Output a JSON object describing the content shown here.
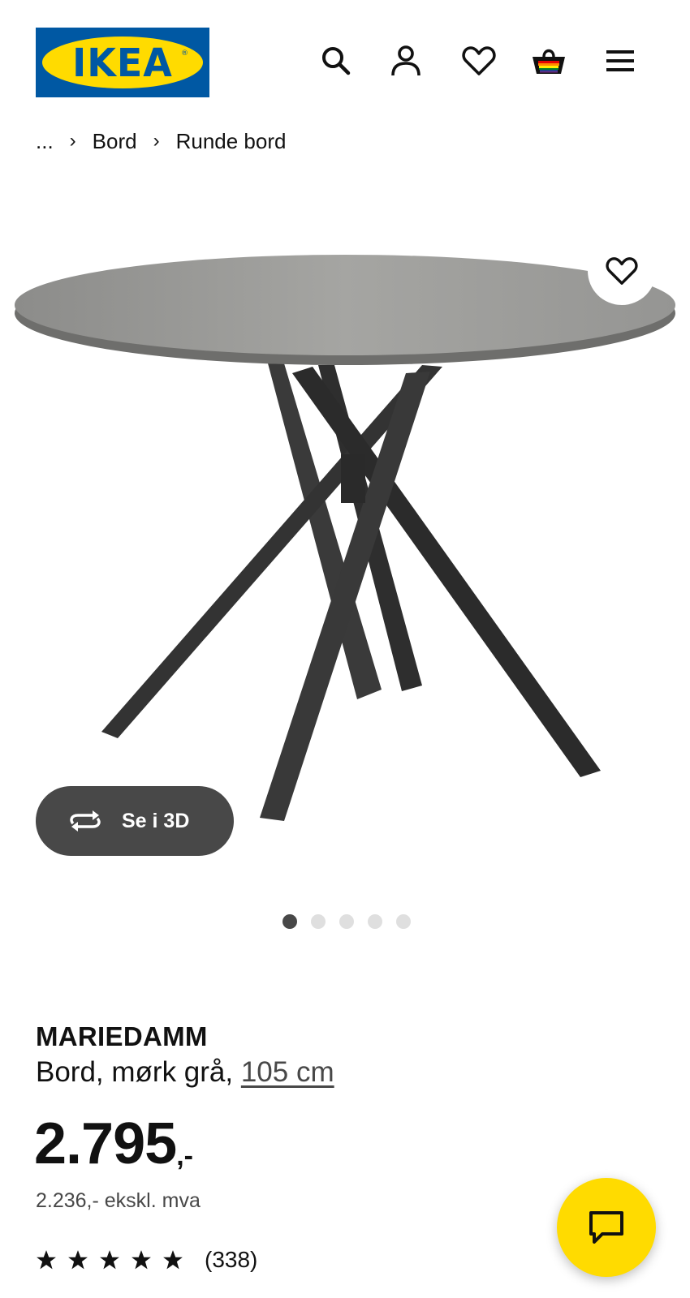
{
  "header": {
    "logo_text": "IKEA",
    "logo_reg": "®",
    "icons": [
      "search-icon",
      "account-icon",
      "favourites-icon",
      "basket-icon",
      "menu-icon"
    ]
  },
  "breadcrumb": {
    "ellipsis": "...",
    "separator": "›",
    "items": [
      "Bord",
      "Runde bord"
    ]
  },
  "gallery": {
    "view_3d_label": "Se i 3D",
    "image_count": 5,
    "active_index": 0
  },
  "product": {
    "name": "MARIEDAMM",
    "description": "Bord, mørk grå,",
    "size_link": "105 cm",
    "price_main": "2.795",
    "price_suffix": ",-",
    "price_excl_vat": "2.236,- ekskl. mva",
    "rating_stars": 5,
    "rating_count": "(338)"
  },
  "colors": {
    "brand_blue": "#0058a3",
    "brand_yellow": "#ffdb00",
    "button_dark": "#484848"
  }
}
